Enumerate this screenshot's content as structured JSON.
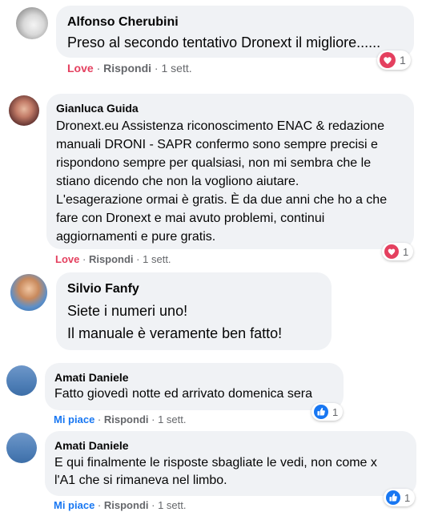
{
  "comments": [
    {
      "author": "Alfonso Cherubini",
      "lines": [
        "Preso al secondo tentativo Dronext il migliore......"
      ],
      "reaction_label": "Love",
      "reply_label": "Rispondi",
      "time": "1 sett.",
      "reaction_icon": "heart-icon",
      "reaction_count": "1",
      "separator": "·"
    },
    {
      "author": "Gianluca Guida",
      "lines": [
        "Dronext.eu Assistenza riconoscimento ENAC & redazione",
        "manuali DRONI - SAPR confermo sono sempre precisi e",
        "rispondono sempre per qualsiasi, non mi sembra che le",
        "stiano dicendo che non la vogliono aiutare.",
        "L'esagerazione ormai è gratis. È da due anni che ho a che",
        "fare con Dronext e mai avuto problemi, continui",
        "aggiornamenti e pure gratis."
      ],
      "reaction_label": "Love",
      "reply_label": "Rispondi",
      "time": "1 sett.",
      "reaction_icon": "heart-icon",
      "reaction_count": "1",
      "separator": "·"
    },
    {
      "author": "Silvio Fanfy",
      "lines": [
        "Siete i numeri uno!",
        "Il manuale è veramente ben fatto!"
      ]
    },
    {
      "author": "Amati Daniele",
      "lines": [
        "Fatto giovedì notte ed arrivato domenica sera"
      ],
      "reaction_label": "Mi piace",
      "reply_label": "Rispondi",
      "time": "1 sett.",
      "reaction_icon": "thumbs-up-icon",
      "reaction_count": "1",
      "separator": "·"
    },
    {
      "author": "Amati Daniele",
      "lines": [
        "E qui finalmente le risposte sbagliate le vedi, non come x",
        "l'A1 che si rimaneva nel limbo."
      ],
      "reaction_label": "Mi piace",
      "reply_label": "Rispondi",
      "time": "1 sett.",
      "reaction_icon": "thumbs-up-icon",
      "reaction_count": "1",
      "separator": "·"
    }
  ],
  "colors": {
    "bubble": "#f0f2f5",
    "love": "#e4405f",
    "like": "#1877f2",
    "meta": "#65676b"
  }
}
